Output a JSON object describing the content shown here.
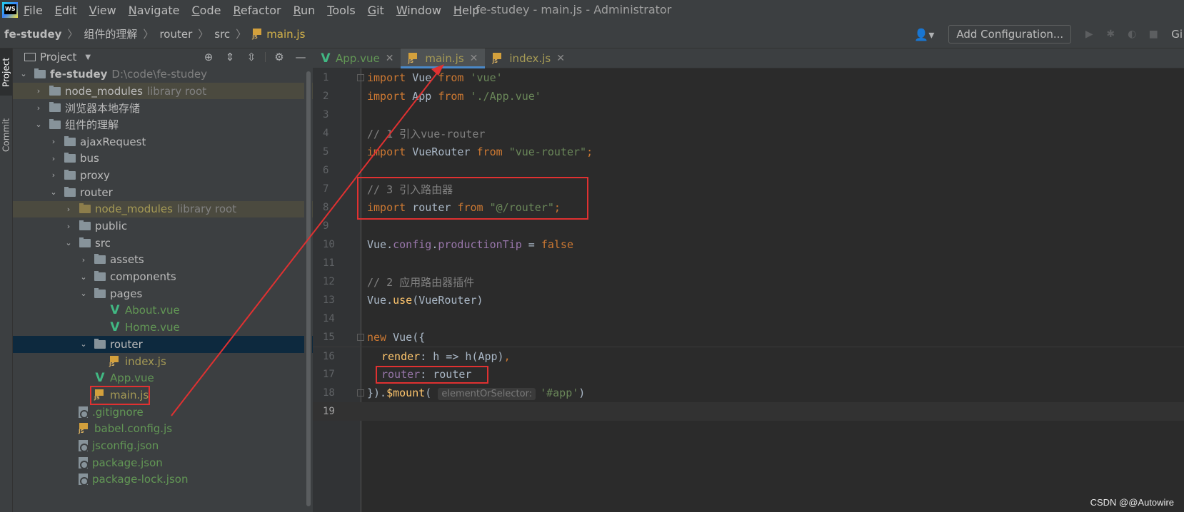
{
  "menubar": {
    "items": [
      "File",
      "Edit",
      "View",
      "Navigate",
      "Code",
      "Refactor",
      "Run",
      "Tools",
      "Git",
      "Window",
      "Help"
    ],
    "window_title": "fe-studey - main.js - Administrator"
  },
  "breadcrumb": {
    "project": "fe-studey",
    "folder1": "组件的理解",
    "folder2": "router",
    "folder3": "src",
    "file": "main.js"
  },
  "toolbar": {
    "add_configuration": "Add Configuration...",
    "git": "Gi"
  },
  "side_strip": {
    "project_tab": "Project",
    "commit_tab": "Commit"
  },
  "project_panel": {
    "title": "Project",
    "root_name": "fe-studey",
    "root_path": "D:\\code\\fe-studey",
    "library_root_hint": "library root",
    "items": [
      {
        "label": "node_modules"
      },
      {
        "label": "浏览器本地存储"
      },
      {
        "label": "组件的理解"
      },
      {
        "label": "ajaxRequest"
      },
      {
        "label": "bus"
      },
      {
        "label": "proxy"
      },
      {
        "label": "router"
      },
      {
        "label": "node_modules"
      },
      {
        "label": "public"
      },
      {
        "label": "src"
      },
      {
        "label": "assets"
      },
      {
        "label": "components"
      },
      {
        "label": "pages"
      },
      {
        "label": "About.vue"
      },
      {
        "label": "Home.vue"
      },
      {
        "label": "router"
      },
      {
        "label": "index.js"
      },
      {
        "label": "App.vue"
      },
      {
        "label": "main.js"
      },
      {
        "label": ".gitignore"
      },
      {
        "label": "babel.config.js"
      },
      {
        "label": "jsconfig.json"
      },
      {
        "label": "package.json"
      },
      {
        "label": "package-lock.json"
      }
    ]
  },
  "editor": {
    "tabs": [
      {
        "label": "App.vue"
      },
      {
        "label": "main.js"
      },
      {
        "label": "index.js"
      }
    ],
    "line_numbers": [
      "1",
      "2",
      "3",
      "4",
      "5",
      "6",
      "7",
      "8",
      "9",
      "10",
      "11",
      "12",
      "13",
      "14",
      "15",
      "16",
      "17",
      "18",
      "19"
    ],
    "code": {
      "l1_kw": "import",
      "l1_id": "Vue",
      "l1_from": "from",
      "l1_str": "'vue'",
      "l2_kw": "import",
      "l2_id": "App",
      "l2_from": "from",
      "l2_str": "'./App.vue'",
      "l4_comment": "// 1 引入vue-router",
      "l5_kw": "import",
      "l5_id": "VueRouter",
      "l5_from": "from",
      "l5_str": "\"vue-router\"",
      "l5_semi": ";",
      "l7_comment": "// 3 引入路由器",
      "l8_kw": "import",
      "l8_id": "router",
      "l8_from": "from",
      "l8_str": "\"@/router\"",
      "l8_semi": ";",
      "l10_obj": "Vue",
      "l10_dot1": ".",
      "l10_p1": "config",
      "l10_dot2": ".",
      "l10_p2": "productionTip",
      "l10_eq": " = ",
      "l10_val": "false",
      "l12_comment": "// 2 应用路由器插件",
      "l13_obj": "Vue",
      "l13_dot": ".",
      "l13_fn": "use",
      "l13_args": "(VueRouter)",
      "l15_kw": "new",
      "l15_rest": " Vue({",
      "l16_prop": "render",
      "l16_rest": ": h => h(App)",
      "l16_comma": ",",
      "l17_prop": "router",
      "l17_rest": ": router",
      "l18_pre": "}).",
      "l18_fn": "$mount",
      "l18_paren": "(",
      "l18_hint": "elementOrSelector:",
      "l18_str": "'#app'",
      "l18_close": ")"
    }
  },
  "watermark": "CSDN @@Autowire"
}
